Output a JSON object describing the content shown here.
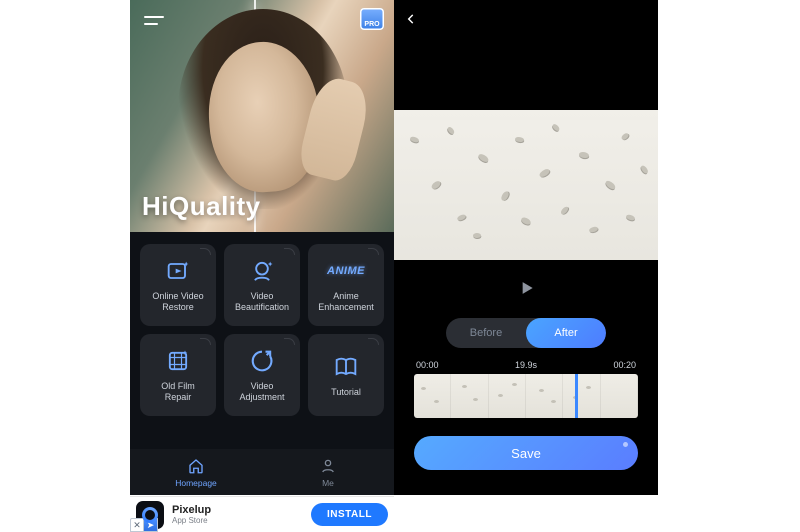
{
  "left": {
    "brand": "HiQuality",
    "pro_badge": "PRO",
    "menu_icon_name": "hamburger-menu-icon",
    "features": [
      {
        "id": "online-video-restore",
        "label": "Online Video\nRestore",
        "icon": "sparkle-video-icon"
      },
      {
        "id": "video-beautification",
        "label": "Video\nBeautification",
        "icon": "face-beautify-icon"
      },
      {
        "id": "anime-enhancement",
        "label": "Anime\nEnhancement",
        "icon": "anime-icon"
      },
      {
        "id": "old-film-repair",
        "label": "Old Film\nRepair",
        "icon": "film-repair-icon"
      },
      {
        "id": "video-adjustment",
        "label": "Video\nAdjustment",
        "icon": "adjust-icon"
      },
      {
        "id": "tutorial",
        "label": "Tutorial",
        "icon": "book-icon"
      }
    ],
    "nav": {
      "home": "Homepage",
      "me": "Me"
    }
  },
  "ad": {
    "title": "Pixelup",
    "subtitle": "App Store",
    "button": "INSTALL"
  },
  "right": {
    "play_icon_name": "play-icon",
    "toggle": {
      "before": "Before",
      "after": "After",
      "active": "after"
    },
    "timeline": {
      "start": "00:00",
      "current": "19.9s",
      "end": "00:20"
    },
    "save": "Save"
  },
  "colors": {
    "accent_blue": "#4a8cff",
    "tile_bg": "#23262c",
    "page_bg_dark": "#0e1116"
  }
}
